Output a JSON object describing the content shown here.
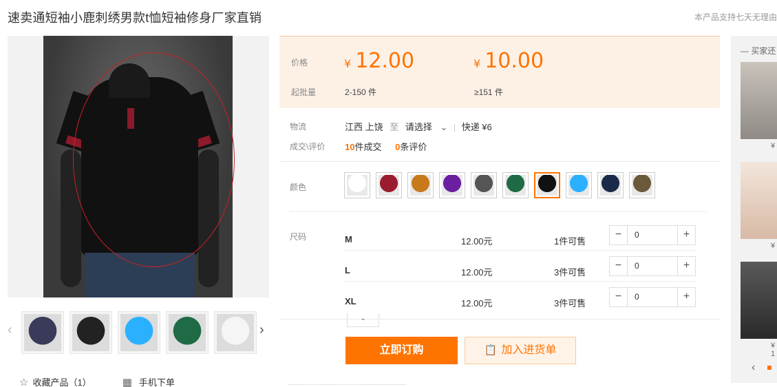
{
  "title": "速卖通短袖小鹿刺绣男款t恤短袖修身厂家直销",
  "notice": "本产品支持七天无理由",
  "price_box": {
    "price_label": "价格",
    "prices": [
      {
        "currency": "¥",
        "amount": "12.00",
        "moq": "2-150 件"
      },
      {
        "currency": "¥",
        "amount": "10.00",
        "moq": "≥151 件"
      }
    ],
    "moq_label": "起批量"
  },
  "logistics": {
    "label": "物流",
    "from": "江西 上饶",
    "to_word": "至",
    "select": "请选择",
    "express": "快递 ¥6"
  },
  "trade": {
    "label": "成交\\评价",
    "deals_count": "10",
    "deals_text": "件成交",
    "reviews_count": "0",
    "reviews_text": "条评价"
  },
  "color": {
    "label": "颜色",
    "swatches": [
      "#ffffff",
      "#9b1c2e",
      "#c8791a",
      "#6a1fa0",
      "#555555",
      "#1e6b45",
      "#111111",
      "#2ab0ff",
      "#1a2a4a",
      "#6b5a3a"
    ],
    "selected_index": 6
  },
  "size": {
    "label": "尺码",
    "rows": [
      {
        "name": "M",
        "price": "12.00元",
        "stock": "1件可售",
        "qty": "0"
      },
      {
        "name": "L",
        "price": "12.00元",
        "stock": "3件可售",
        "qty": "0"
      },
      {
        "name": "XL",
        "price": "12.00元",
        "stock": "3件可售",
        "qty": "0"
      }
    ]
  },
  "buttons": {
    "buy": "立即订购",
    "cart": "加入进货单"
  },
  "bottom": {
    "favorite": "收藏产品（1）",
    "mobile": "手机下单"
  },
  "thumbs": [
    "#3a3a5a",
    "#222222",
    "#2ab0ff",
    "#1e6b45",
    "#f5f5f5"
  ],
  "side": {
    "title": "买家还",
    "prices": [
      "¥",
      "¥",
      "¥ 1"
    ]
  },
  "icons": {
    "stepper_minus": "−",
    "stepper_plus": "+",
    "chevron_down": "⌄",
    "arrow_left": "‹",
    "arrow_right": "›",
    "star": "☆",
    "qr": "▦",
    "clipboard": "📋"
  }
}
